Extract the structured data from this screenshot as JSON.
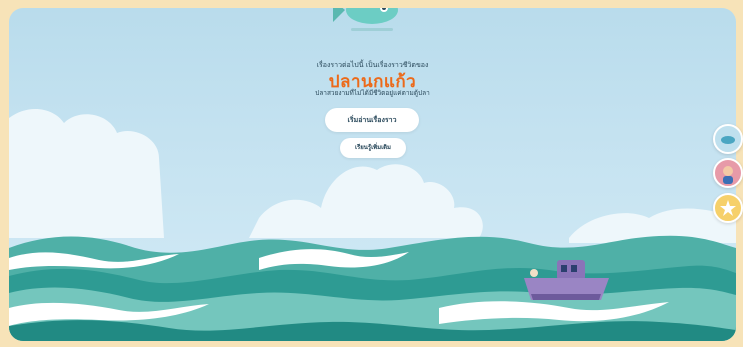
{
  "story": {
    "intro": "เรื่องราวต่อไปนี้ เป็นเรื่องราวชีวิตของ",
    "title": "ปลานกแก้ว",
    "subtitle": "ปลาสวยงามที่ไม่ได้มีชีวิตอยู่แค่ตามตู้ปลา"
  },
  "buttons": {
    "start": "เริ่มอ่านเรื่องราว",
    "learn": "เรียนรู้เพิ่มเติม"
  },
  "side_menu": [
    {
      "icon": "fish-icon"
    },
    {
      "icon": "diver-icon"
    },
    {
      "icon": "star-icon"
    }
  ],
  "colors": {
    "sky": "#c6e3f1",
    "title": "#ec6a1a",
    "wave_dark": "#2e9b93",
    "wave_light": "#74c6bd",
    "boat_hull": "#9a85c4",
    "frame_border": "#f7e3b8"
  }
}
